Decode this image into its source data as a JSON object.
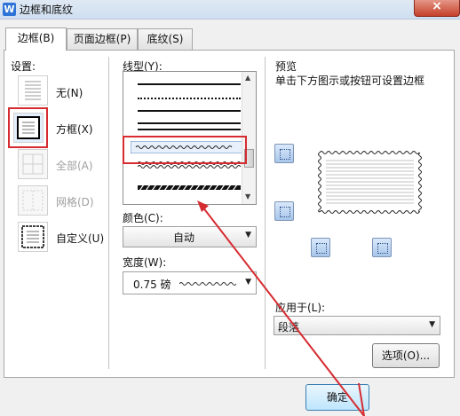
{
  "window": {
    "title": "边框和底纹",
    "app_icon": "W",
    "close_glyph": "×"
  },
  "tabs": [
    {
      "label": "边框(B)",
      "active": true
    },
    {
      "label": "页面边框(P)",
      "active": false
    },
    {
      "label": "底纹(S)",
      "active": false
    }
  ],
  "settings": {
    "heading": "设置:",
    "items": [
      {
        "label": "无(N)",
        "disabled": false
      },
      {
        "label": "方框(X)",
        "disabled": false,
        "selected": true
      },
      {
        "label": "全部(A)",
        "disabled": true
      },
      {
        "label": "网格(D)",
        "disabled": true
      },
      {
        "label": "自定义(U)",
        "disabled": false
      }
    ]
  },
  "line_style": {
    "heading": "线型(Y):",
    "selected": "wave"
  },
  "color": {
    "heading": "颜色(C):",
    "value": "自动"
  },
  "width": {
    "heading": "宽度(W):",
    "value": "0.75 磅"
  },
  "preview": {
    "heading": "预览",
    "hint": "单击下方图示或按钮可设置边框"
  },
  "apply_to": {
    "heading": "应用于(L):",
    "value": "段落"
  },
  "buttons": {
    "options": "选项(O)...",
    "ok": "确定"
  },
  "colors": {
    "highlight_red": "#d62b30",
    "accent_blue": "#2d74d6"
  }
}
